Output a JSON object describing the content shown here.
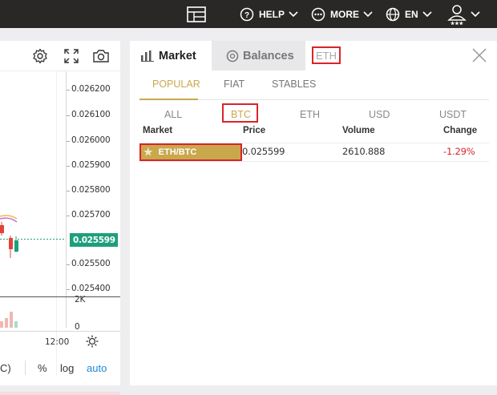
{
  "topbar": {
    "help_label": "HELP",
    "more_label": "MORE",
    "lang_label": "EN"
  },
  "chart": {
    "price_ticks": [
      "0.026200",
      "0.026100",
      "0.026000",
      "0.025900",
      "0.025800",
      "0.025700",
      "0.025500",
      "0.025400"
    ],
    "last_price": "0.025599",
    "volume_ticks": [
      "2K",
      "0"
    ],
    "time_tick": "12:00",
    "footer": {
      "partial_label": "C)",
      "percent_label": "%",
      "log_label": "log",
      "auto_label": "auto"
    },
    "accent_color": "#1e9f7c"
  },
  "market": {
    "tabs": {
      "market_label": "Market",
      "balances_label": "Balances"
    },
    "search_value": "ETH",
    "categories": [
      "POPULAR",
      "FIAT",
      "STABLES"
    ],
    "quotes": [
      "ALL",
      "BTC",
      "ETH",
      "USD",
      "USDT"
    ],
    "columns": [
      "Market",
      "Price",
      "Volume",
      "Change"
    ],
    "rows": [
      {
        "pair": "ETH/BTC",
        "price": "0.025599",
        "volume": "2610.888",
        "change": "-1.29%"
      }
    ],
    "accent_color": "#c9a84c",
    "negative_color": "#d9242a"
  }
}
